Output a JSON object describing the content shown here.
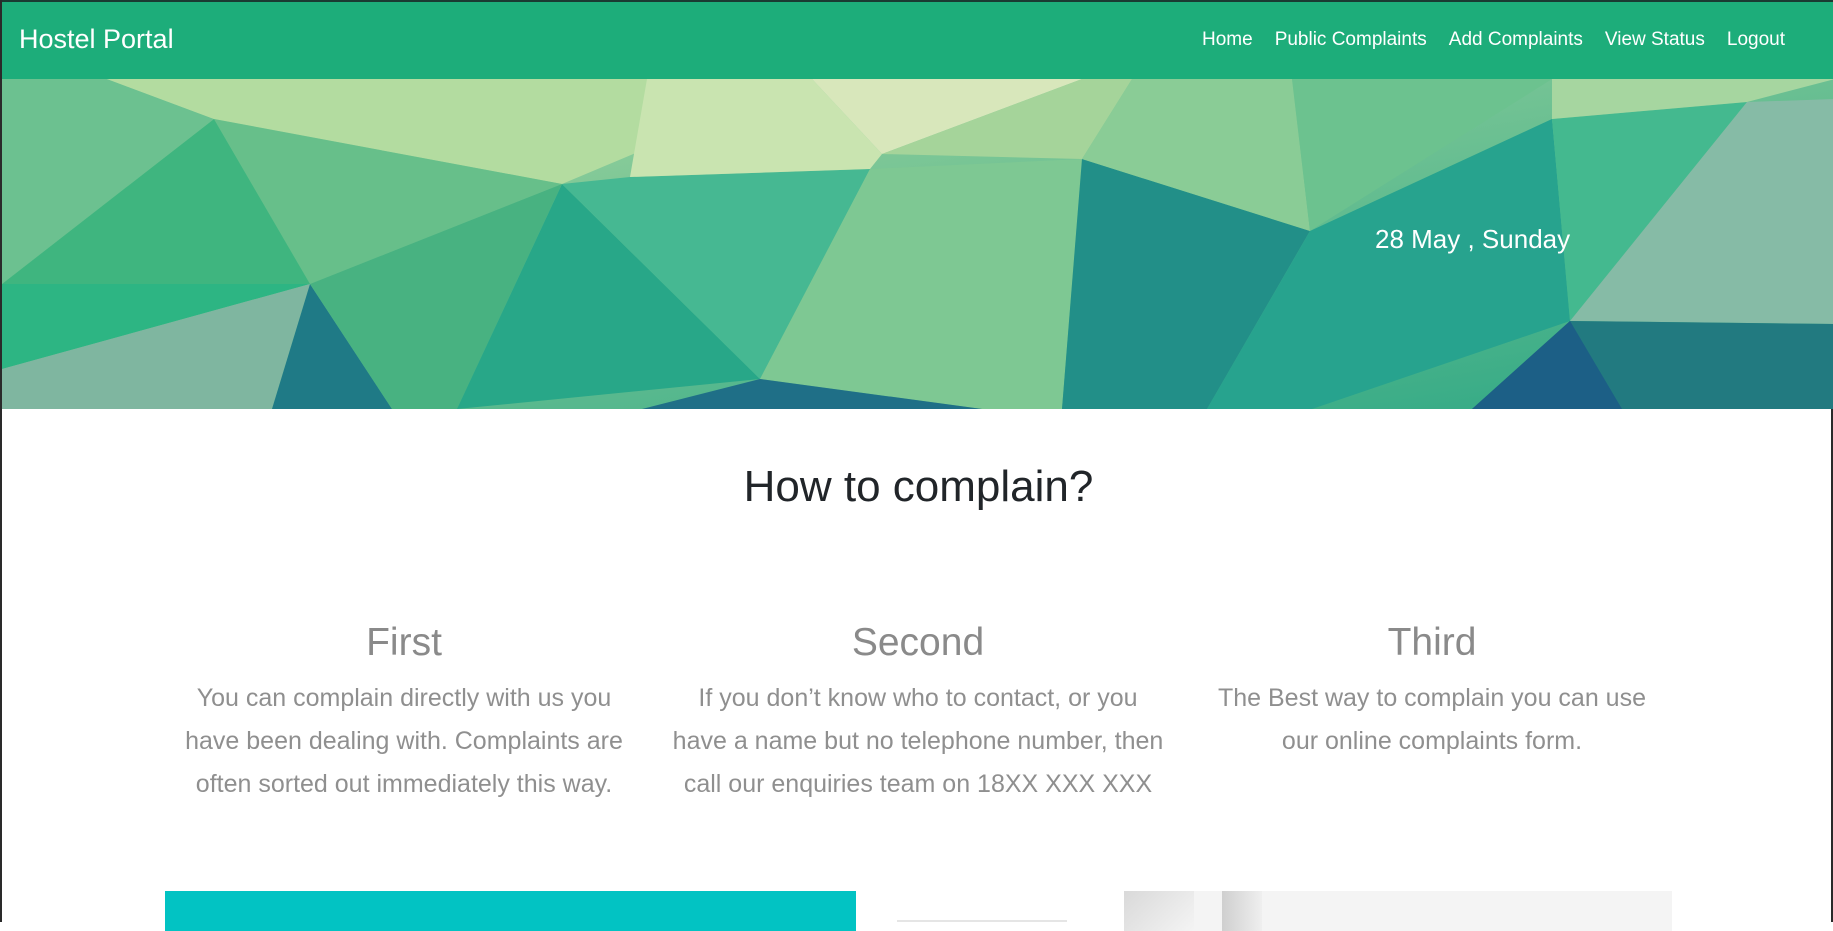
{
  "navbar": {
    "brand": "Hostel Portal",
    "links": [
      "Home",
      "Public Complaints",
      "Add Complaints",
      "View Status",
      "Logout"
    ],
    "color": "#1dad7a"
  },
  "hero": {
    "date": "28 May , Sunday"
  },
  "main": {
    "title": "How to complain?",
    "steps": [
      {
        "heading": "First",
        "text": "You can complain directly with us you have been dealing with. Complaints are often sorted out immediately this way."
      },
      {
        "heading": "Second",
        "text": "If you don’t know who to contact, or you have a name but no telephone number, then call our enquiries team on 18XX XXX XXX"
      },
      {
        "heading": "Third",
        "text": "The Best way to complain you can use our online complaints form."
      }
    ]
  },
  "colors": {
    "accent": "#1dad7a",
    "teal_card": "#02c3c3"
  }
}
